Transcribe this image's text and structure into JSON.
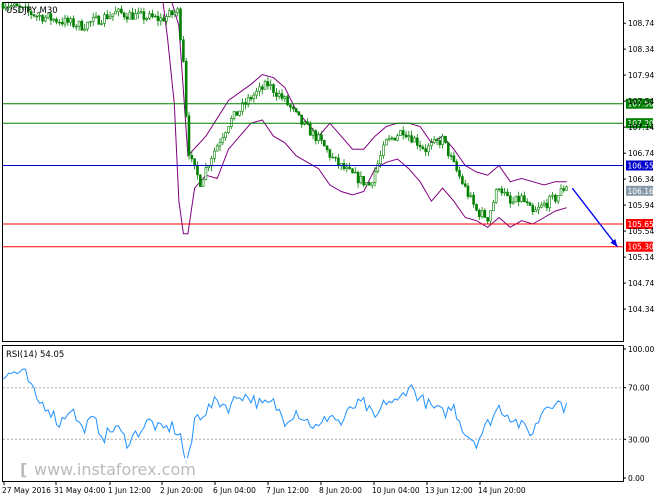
{
  "header": {
    "symbol": "USDJPY,M30"
  },
  "rsi_header": {
    "label": "RSI(14) 54.05"
  },
  "watermark": {
    "text": "www.instaforex.com",
    "bracket": "["
  },
  "colors": {
    "candle": "#008000",
    "bollinger": "#800080",
    "level_resistance": "#008000",
    "level_pivot": "#0000cc",
    "level_support": "#ff0000",
    "current": "#8899aa",
    "rsi_line": "#1e90ff",
    "arrow": "#0000ee",
    "axis_text": "#000000"
  },
  "chart_data": [
    {
      "type": "candlestick",
      "title": "USDJPY,M30",
      "ylim": [
        103.85,
        109.05
      ],
      "y_ticks": [
        104.34,
        104.74,
        105.14,
        105.54,
        105.94,
        106.34,
        106.74,
        107.14,
        107.54,
        107.94,
        108.34,
        108.74
      ],
      "x_ticks": [
        "27 May 2016",
        "31 May 04:00",
        "1 Jun 12:00",
        "2 Jun 20:00",
        "6 Jun 04:00",
        "7 Jun 12:00",
        "8 Jun 20:00",
        "10 Jun 04:00",
        "13 Jun 12:00",
        "14 Jun 20:00"
      ],
      "price_path": [
        [
          0,
          109.05
        ],
        [
          3,
          108.86
        ],
        [
          7,
          108.7
        ],
        [
          10,
          108.9
        ],
        [
          14,
          108.8
        ],
        [
          15.5,
          108.92
        ],
        [
          16,
          108.2
        ],
        [
          16.4,
          106.85
        ],
        [
          16.8,
          106.55
        ],
        [
          17.5,
          106.3
        ],
        [
          18.5,
          106.7
        ],
        [
          20,
          107.2
        ],
        [
          21,
          107.4
        ],
        [
          22,
          107.6
        ],
        [
          23.5,
          107.8
        ],
        [
          25,
          107.55
        ],
        [
          26.5,
          107.2
        ],
        [
          28,
          106.95
        ],
        [
          29.5,
          106.6
        ],
        [
          31,
          106.4
        ],
        [
          32.5,
          106.25
        ],
        [
          34,
          106.9
        ],
        [
          35.5,
          107.1
        ],
        [
          36.5,
          106.95
        ],
        [
          37.5,
          106.8
        ],
        [
          39,
          106.95
        ],
        [
          40,
          106.55
        ],
        [
          41,
          106.2
        ],
        [
          42,
          105.85
        ],
        [
          43,
          105.75
        ],
        [
          44,
          106.25
        ],
        [
          45,
          105.95
        ],
        [
          46,
          106.05
        ],
        [
          47,
          105.8
        ],
        [
          48,
          105.95
        ],
        [
          49,
          106.05
        ],
        [
          50,
          106.25
        ]
      ],
      "bollinger_upper": [
        [
          15,
          109.05
        ],
        [
          15.6,
          108.7
        ],
        [
          16.4,
          106.7
        ],
        [
          18,
          107.0
        ],
        [
          20,
          107.55
        ],
        [
          22,
          107.8
        ],
        [
          23,
          107.95
        ],
        [
          24,
          107.9
        ],
        [
          25,
          107.75
        ],
        [
          26,
          107.4
        ],
        [
          27,
          107.2
        ],
        [
          28,
          107.0
        ],
        [
          29,
          107.2
        ],
        [
          30,
          107.0
        ],
        [
          31,
          106.8
        ],
        [
          32,
          106.8
        ],
        [
          33,
          107.0
        ],
        [
          34,
          107.15
        ],
        [
          35,
          107.2
        ],
        [
          36,
          107.2
        ],
        [
          37,
          107.15
        ],
        [
          38,
          106.9
        ],
        [
          39,
          107.0
        ],
        [
          40,
          106.8
        ],
        [
          41,
          106.55
        ],
        [
          42,
          106.45
        ],
        [
          43,
          106.4
        ],
        [
          44,
          106.55
        ],
        [
          45,
          106.3
        ],
        [
          46,
          106.35
        ],
        [
          47,
          106.3
        ],
        [
          48,
          106.25
        ],
        [
          49,
          106.3
        ],
        [
          50,
          106.3
        ]
      ],
      "bollinger_lower": [
        [
          14.2,
          109.05
        ],
        [
          14.6,
          108.5
        ],
        [
          15.2,
          107.5
        ],
        [
          15.6,
          106.0
        ],
        [
          16,
          105.5
        ],
        [
          16.4,
          105.5
        ],
        [
          17,
          106.2
        ],
        [
          18,
          106.4
        ],
        [
          19,
          106.35
        ],
        [
          20,
          106.8
        ],
        [
          21,
          107.0
        ],
        [
          22,
          107.2
        ],
        [
          23,
          107.25
        ],
        [
          24,
          107.0
        ],
        [
          25,
          106.9
        ],
        [
          26,
          106.7
        ],
        [
          27,
          106.6
        ],
        [
          28,
          106.5
        ],
        [
          29,
          106.25
        ],
        [
          30,
          106.15
        ],
        [
          31,
          106.1
        ],
        [
          32,
          106.15
        ],
        [
          33,
          106.5
        ],
        [
          34,
          106.6
        ],
        [
          35,
          106.65
        ],
        [
          36,
          106.5
        ],
        [
          37,
          106.3
        ],
        [
          38,
          106.0
        ],
        [
          39,
          106.2
        ],
        [
          40,
          106.0
        ],
        [
          41,
          105.75
        ],
        [
          42,
          105.7
        ],
        [
          43,
          105.6
        ],
        [
          44,
          105.75
        ],
        [
          45,
          105.6
        ],
        [
          46,
          105.7
        ],
        [
          47,
          105.65
        ],
        [
          48,
          105.75
        ],
        [
          49,
          105.85
        ],
        [
          50,
          105.9
        ]
      ],
      "levels": [
        {
          "label": "107.50",
          "value": 107.5,
          "role": "resistance"
        },
        {
          "label": "107.20",
          "value": 107.2,
          "role": "resistance"
        },
        {
          "label": "106.55",
          "value": 106.55,
          "role": "pivot"
        },
        {
          "label": "106.16",
          "value": 106.16,
          "role": "current"
        },
        {
          "label": "105.65",
          "value": 105.65,
          "role": "support"
        },
        {
          "label": "105.30",
          "value": 105.3,
          "role": "support"
        }
      ],
      "projection_arrow": {
        "from": [
          50.5,
          106.2
        ],
        "to": [
          54.5,
          105.3
        ]
      }
    },
    {
      "type": "line",
      "title": "RSI(14) 54.05",
      "ylim": [
        0,
        100
      ],
      "y_ticks": [
        "0.00",
        "30.00",
        "70.00",
        "100.00"
      ],
      "reference_levels": [
        30,
        70
      ],
      "rsi_path": [
        [
          0,
          78
        ],
        [
          1,
          82
        ],
        [
          2,
          80
        ],
        [
          3,
          60
        ],
        [
          4,
          55
        ],
        [
          5,
          42
        ],
        [
          6,
          55
        ],
        [
          7,
          38
        ],
        [
          8,
          45
        ],
        [
          9,
          32
        ],
        [
          10,
          40
        ],
        [
          11,
          28
        ],
        [
          12,
          36
        ],
        [
          13,
          44
        ],
        [
          14,
          37
        ],
        [
          15,
          40
        ],
        [
          15.8,
          32
        ],
        [
          16.2,
          10
        ],
        [
          16.6,
          18
        ],
        [
          17,
          46
        ],
        [
          18,
          52
        ],
        [
          19,
          60
        ],
        [
          20,
          55
        ],
        [
          21,
          65
        ],
        [
          22,
          62
        ],
        [
          23,
          56
        ],
        [
          24,
          58
        ],
        [
          25,
          45
        ],
        [
          26,
          52
        ],
        [
          27,
          44
        ],
        [
          28,
          38
        ],
        [
          29,
          50
        ],
        [
          30,
          42
        ],
        [
          31,
          55
        ],
        [
          32,
          58
        ],
        [
          33,
          45
        ],
        [
          34,
          60
        ],
        [
          35,
          58
        ],
        [
          36,
          72
        ],
        [
          37,
          62
        ],
        [
          38,
          55
        ],
        [
          39,
          50
        ],
        [
          40,
          55
        ],
        [
          41,
          35
        ],
        [
          42,
          28
        ],
        [
          43,
          42
        ],
        [
          44,
          55
        ],
        [
          45,
          48
        ],
        [
          46,
          40
        ],
        [
          47,
          35
        ],
        [
          48,
          55
        ],
        [
          49,
          60
        ],
        [
          50,
          54
        ]
      ]
    }
  ]
}
